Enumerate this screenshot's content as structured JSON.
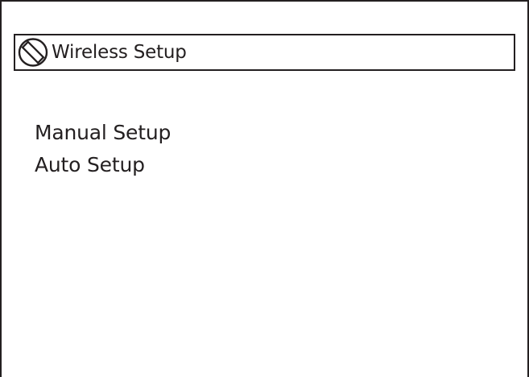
{
  "header": {
    "title": "Wireless Setup",
    "icon": "wireless-setup-icon"
  },
  "menu": {
    "items": [
      {
        "label": "Manual Setup"
      },
      {
        "label": "Auto Setup"
      }
    ]
  }
}
